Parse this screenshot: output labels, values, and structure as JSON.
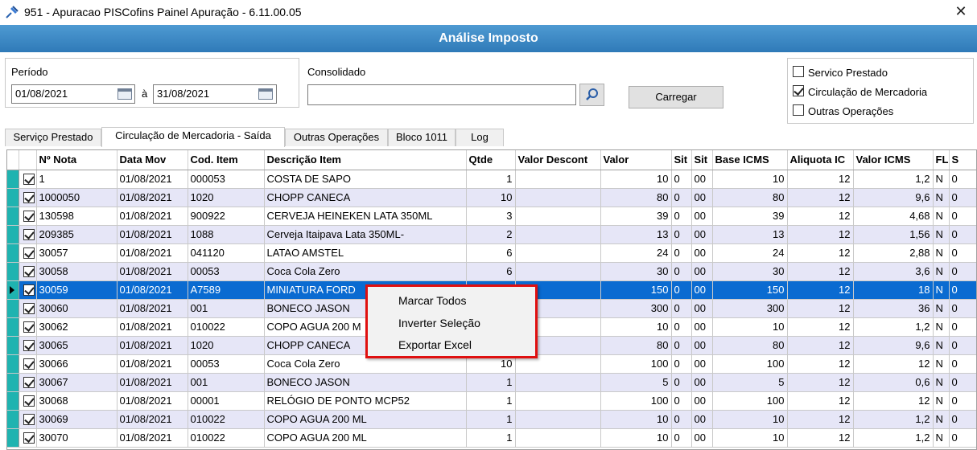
{
  "window": {
    "title": "951 - Apuracao PISCofins Painel Apuração - 6.11.00.05",
    "banner": "Análise Imposto",
    "close_symbol": "✕"
  },
  "filters": {
    "periodo_label": "Período",
    "date_from": "01/08/2021",
    "date_sep": "à",
    "date_to": "31/08/2021",
    "consolidado_label": "Consolidado",
    "consolidado_value": "",
    "load_button": "Carregar",
    "options": [
      {
        "label": "Servico Prestado",
        "checked": false
      },
      {
        "label": "Circulação de Mercadoria",
        "checked": true
      },
      {
        "label": "Outras Operações",
        "checked": false
      }
    ]
  },
  "tabs": [
    {
      "label": "Serviço Prestado",
      "active": false
    },
    {
      "label": "Circulação de Mercadoria - Saída",
      "active": true
    },
    {
      "label": "Outras Operações",
      "active": false
    },
    {
      "label": "Bloco 1011",
      "active": false
    },
    {
      "label": "Log",
      "active": false
    }
  ],
  "grid": {
    "columns": [
      "Nº Nota",
      "Data Mov",
      "Cod. Item",
      "Descrição Item",
      "Qtde",
      "Valor Descont",
      "Valor",
      "Sit",
      "Sit",
      "Base ICMS",
      "Aliquota IC",
      "Valor ICMS",
      "FL",
      "S"
    ],
    "rows": [
      {
        "nota": "1",
        "data": "01/08/2021",
        "cod": "000053",
        "desc": "COSTA DE SAPO",
        "qtde": "1",
        "desconto": "",
        "valor": "10",
        "sit1": "0",
        "sit2": "00",
        "base": "10",
        "aliq": "12",
        "icms": "1,2",
        "fl": "N",
        "s": "0"
      },
      {
        "nota": "1000050",
        "data": "01/08/2021",
        "cod": "1020",
        "desc": "CHOPP CANECA",
        "qtde": "10",
        "desconto": "",
        "valor": "80",
        "sit1": "0",
        "sit2": "00",
        "base": "80",
        "aliq": "12",
        "icms": "9,6",
        "fl": "N",
        "s": "0"
      },
      {
        "nota": "130598",
        "data": "01/08/2021",
        "cod": "900922",
        "desc": "CERVEJA HEINEKEN LATA 350ML",
        "qtde": "3",
        "desconto": "",
        "valor": "39",
        "sit1": "0",
        "sit2": "00",
        "base": "39",
        "aliq": "12",
        "icms": "4,68",
        "fl": "N",
        "s": "0"
      },
      {
        "nota": "209385",
        "data": "01/08/2021",
        "cod": "1088",
        "desc": "Cerveja Itaipava Lata 350ML-",
        "qtde": "2",
        "desconto": "",
        "valor": "13",
        "sit1": "0",
        "sit2": "00",
        "base": "13",
        "aliq": "12",
        "icms": "1,56",
        "fl": "N",
        "s": "0"
      },
      {
        "nota": "30057",
        "data": "01/08/2021",
        "cod": "041120",
        "desc": "LATAO AMSTEL",
        "qtde": "6",
        "desconto": "",
        "valor": "24",
        "sit1": "0",
        "sit2": "00",
        "base": "24",
        "aliq": "12",
        "icms": "2,88",
        "fl": "N",
        "s": "0"
      },
      {
        "nota": "30058",
        "data": "01/08/2021",
        "cod": "00053",
        "desc": "Coca Cola Zero",
        "qtde": "6",
        "desconto": "",
        "valor": "30",
        "sit1": "0",
        "sit2": "00",
        "base": "30",
        "aliq": "12",
        "icms": "3,6",
        "fl": "N",
        "s": "0"
      },
      {
        "nota": "30059",
        "data": "01/08/2021",
        "cod": "A7589",
        "desc": "MINIATURA FORD",
        "qtde": "",
        "desconto": "",
        "valor": "150",
        "sit1": "0",
        "sit2": "00",
        "base": "150",
        "aliq": "12",
        "icms": "18",
        "fl": "N",
        "s": "0",
        "selected": true
      },
      {
        "nota": "30060",
        "data": "01/08/2021",
        "cod": "001",
        "desc": "BONECO JASON",
        "qtde": "",
        "desconto": "",
        "valor": "300",
        "sit1": "0",
        "sit2": "00",
        "base": "300",
        "aliq": "12",
        "icms": "36",
        "fl": "N",
        "s": "0"
      },
      {
        "nota": "30062",
        "data": "01/08/2021",
        "cod": "010022",
        "desc": "COPO AGUA 200 M",
        "qtde": "",
        "desconto": "",
        "valor": "10",
        "sit1": "0",
        "sit2": "00",
        "base": "10",
        "aliq": "12",
        "icms": "1,2",
        "fl": "N",
        "s": "0"
      },
      {
        "nota": "30065",
        "data": "01/08/2021",
        "cod": "1020",
        "desc": "CHOPP CANECA",
        "qtde": "",
        "desconto": "",
        "valor": "80",
        "sit1": "0",
        "sit2": "00",
        "base": "80",
        "aliq": "12",
        "icms": "9,6",
        "fl": "N",
        "s": "0"
      },
      {
        "nota": "30066",
        "data": "01/08/2021",
        "cod": "00053",
        "desc": "Coca Cola Zero",
        "qtde": "10",
        "desconto": "",
        "valor": "100",
        "sit1": "0",
        "sit2": "00",
        "base": "100",
        "aliq": "12",
        "icms": "12",
        "fl": "N",
        "s": "0"
      },
      {
        "nota": "30067",
        "data": "01/08/2021",
        "cod": "001",
        "desc": "BONECO JASON",
        "qtde": "1",
        "desconto": "",
        "valor": "5",
        "sit1": "0",
        "sit2": "00",
        "base": "5",
        "aliq": "12",
        "icms": "0,6",
        "fl": "N",
        "s": "0"
      },
      {
        "nota": "30068",
        "data": "01/08/2021",
        "cod": "00001",
        "desc": "RELÓGIO DE PONTO MCP52",
        "qtde": "1",
        "desconto": "",
        "valor": "100",
        "sit1": "0",
        "sit2": "00",
        "base": "100",
        "aliq": "12",
        "icms": "12",
        "fl": "N",
        "s": "0"
      },
      {
        "nota": "30069",
        "data": "01/08/2021",
        "cod": "010022",
        "desc": "COPO AGUA 200 ML",
        "qtde": "1",
        "desconto": "",
        "valor": "10",
        "sit1": "0",
        "sit2": "00",
        "base": "10",
        "aliq": "12",
        "icms": "1,2",
        "fl": "N",
        "s": "0"
      },
      {
        "nota": "30070",
        "data": "01/08/2021",
        "cod": "010022",
        "desc": "COPO AGUA 200 ML",
        "qtde": "1",
        "desconto": "",
        "valor": "10",
        "sit1": "0",
        "sit2": "00",
        "base": "10",
        "aliq": "12",
        "icms": "1,2",
        "fl": "N",
        "s": "0"
      }
    ]
  },
  "context_menu": {
    "items": [
      "Marcar Todos",
      "Inverter Seleção",
      "Exportar Excel"
    ]
  },
  "colors": {
    "banner": "#2f7ab8",
    "row_alt": "#e6e6f7",
    "row_selected": "#0a6bd1",
    "marker": "#1fb3b0",
    "menu_highlight_border": "#e01010"
  },
  "icons": {
    "app": "pin-icon",
    "calendar": "calendar-icon",
    "search": "search-icon",
    "close": "close-icon"
  }
}
